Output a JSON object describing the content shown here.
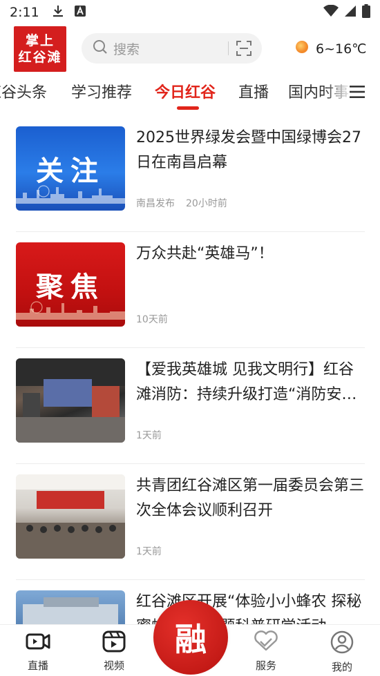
{
  "status_bar": {
    "time": "2:11"
  },
  "header": {
    "logo_line1": "掌上",
    "logo_line2": "红谷滩",
    "search_placeholder": "搜索",
    "weather_text": "6~16℃"
  },
  "tabs": [
    {
      "label": "红谷头条",
      "active": false
    },
    {
      "label": "学习推荐",
      "active": false
    },
    {
      "label": "今日红谷",
      "active": true
    },
    {
      "label": "直播",
      "active": false
    },
    {
      "label": "国内时事",
      "active": false
    }
  ],
  "news": [
    {
      "title": "2025世界绿发会暨中国绿博会27日在南昌启幕",
      "source": "南昌发布",
      "time": "20小时前",
      "thumb_text": "关注"
    },
    {
      "title": "万众共赴“英雄马”！",
      "source": "",
      "time": "10天前",
      "thumb_text": "聚焦"
    },
    {
      "title": "【爱我英雄城 见我文明行】红谷滩消防：持续升级打造“消防安全示范街区”",
      "source": "",
      "time": "1天前",
      "thumb_text": ""
    },
    {
      "title": "共青团红谷滩区第一届委员会第三次全体会议顺利召开",
      "source": "",
      "time": "1天前",
      "thumb_text": ""
    },
    {
      "title": "红谷滩区开展“体验小小蜂农 探秘蜜蜂王国”主题科普研学活动",
      "source": "",
      "time": "",
      "thumb_text": ""
    }
  ],
  "bottom_nav": {
    "live": "直播",
    "video": "视频",
    "center": "融",
    "service": "服务",
    "mine": "我的"
  },
  "colors": {
    "accent": "#e1251b",
    "logo_bg": "#d41e1e"
  }
}
